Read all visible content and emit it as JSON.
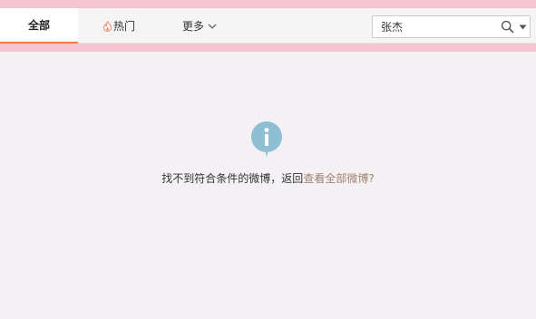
{
  "nav": {
    "tabs": [
      {
        "label": "全部",
        "active": true
      },
      {
        "label": "热门",
        "icon": "flame-icon"
      },
      {
        "label": "更多",
        "icon": "chevron-down-icon"
      }
    ]
  },
  "search": {
    "value": "张杰",
    "icons": [
      "search-icon",
      "caret-down-icon"
    ]
  },
  "empty_state": {
    "icon": "info-icon",
    "message": "找不到符合条件的微博，返回",
    "link": "查看全部微博?"
  },
  "colors": {
    "band": "#f4c4d0",
    "active_tab_underline": "#fa7d3c",
    "info_icon": "#8fbfd3",
    "link": "#a08170"
  }
}
